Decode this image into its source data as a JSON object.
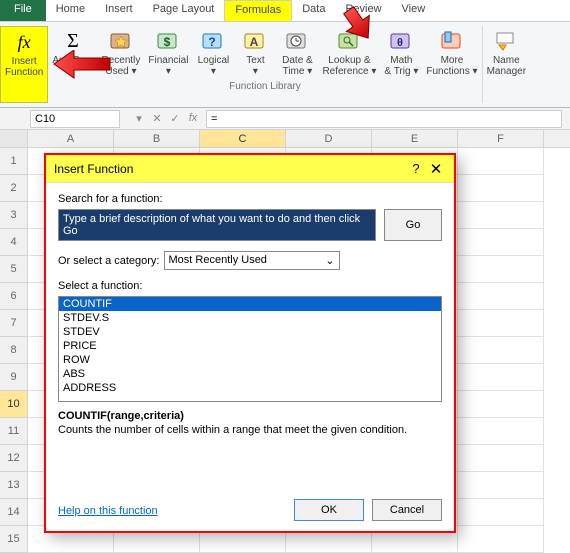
{
  "tabs": {
    "file": "File",
    "home": "Home",
    "insert": "Insert",
    "page_layout": "Page Layout",
    "formulas": "Formulas",
    "data": "Data",
    "review": "Review",
    "view": "View",
    "active": "Formulas"
  },
  "ribbon": {
    "insert_function": "Insert\nFunction",
    "autosum": "AutoSum",
    "recently_used": "Recently\nUsed",
    "financial": "Financial",
    "logical": "Logical",
    "text": "Text",
    "date_time": "Date &\nTime",
    "lookup_ref": "Lookup &\nReference",
    "math_trig": "Math\n& Trig",
    "more_funcs": "More\nFunctions",
    "name_manager": "Name\nManager",
    "group_label": "Function Library"
  },
  "formula_bar": {
    "namebox": "C10",
    "formula": "=",
    "fx": "fx",
    "dd": "▾",
    "x": "✕",
    "chk": "✓"
  },
  "columns": [
    "A",
    "B",
    "C",
    "D",
    "E",
    "F"
  ],
  "rows": [
    1,
    2,
    3,
    4,
    5,
    6,
    7,
    8,
    9,
    10,
    11,
    12,
    13,
    14,
    15
  ],
  "dialog": {
    "title": "Insert Function",
    "help": "?",
    "close": "✕",
    "search_label": "Search for a function:",
    "search_text": "Type a brief description of what you want to do and then click Go",
    "go": "Go",
    "category_label": "Or select a category:",
    "category_value": "Most Recently Used",
    "select_label": "Select a function:",
    "functions": [
      "COUNTIF",
      "STDEV.S",
      "STDEV",
      "PRICE",
      "ROW",
      "ABS",
      "ADDRESS"
    ],
    "selected_fn": "COUNTIF",
    "signature": "COUNTIF(range,criteria)",
    "description": "Counts the number of cells within a range that meet the given condition.",
    "help_link": "Help on this function",
    "ok": "OK",
    "cancel": "Cancel"
  },
  "icons": {
    "fx_big": "fx",
    "sigma": "Σ",
    "chevron": "▾",
    "dropdown": "⌄"
  }
}
